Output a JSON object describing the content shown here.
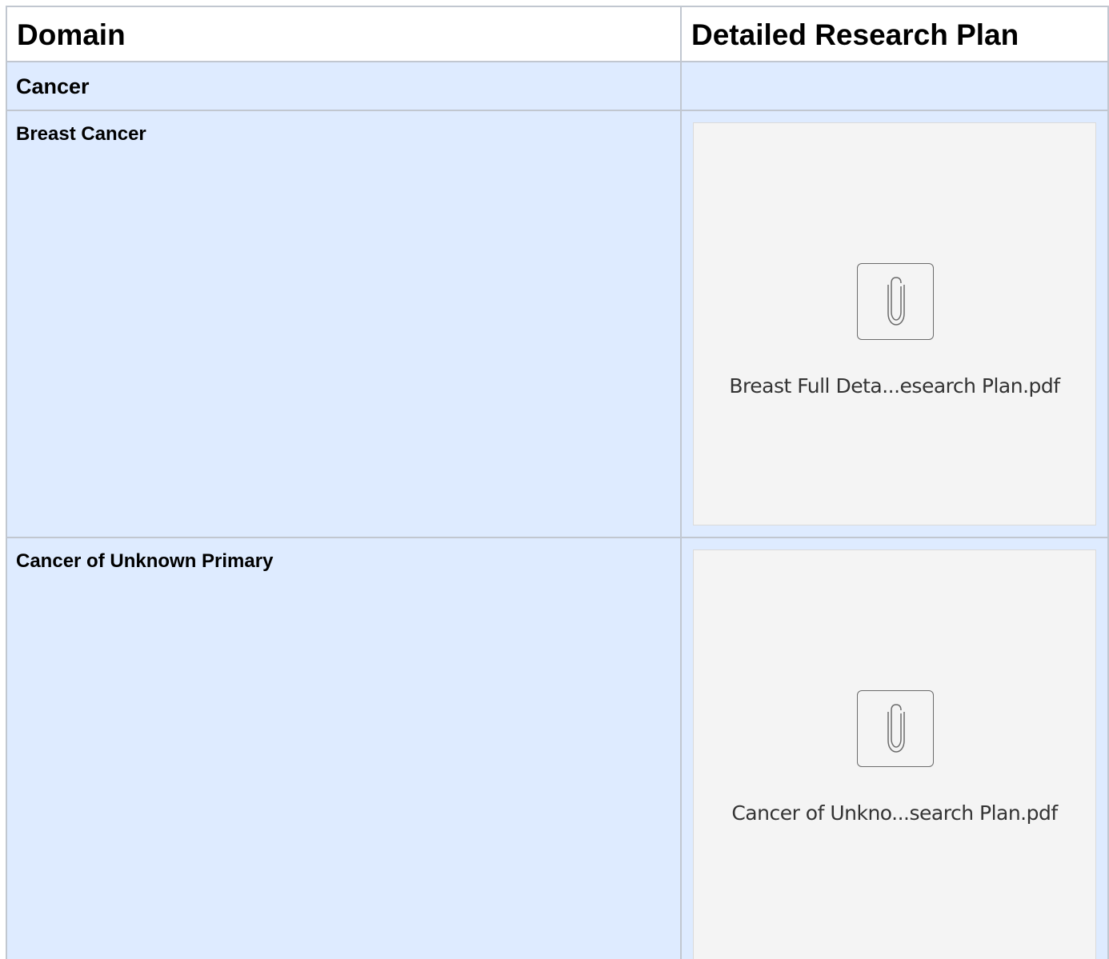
{
  "table": {
    "headers": {
      "domain": "Domain",
      "plan": "Detailed Research Plan"
    },
    "group": {
      "label": "Cancer"
    },
    "rows": [
      {
        "domain": "Breast Cancer",
        "attachment": {
          "file_name": "Breast Full Deta...esearch Plan.pdf",
          "icon": "paperclip-icon"
        }
      },
      {
        "domain": "Cancer of Unknown Primary",
        "attachment": {
          "file_name": "Cancer of Unkno...search Plan.pdf",
          "icon": "paperclip-icon"
        }
      }
    ]
  },
  "colors": {
    "row_background": "#deebff",
    "border": "#c1c7d0",
    "attachment_background": "#f4f4f4"
  }
}
